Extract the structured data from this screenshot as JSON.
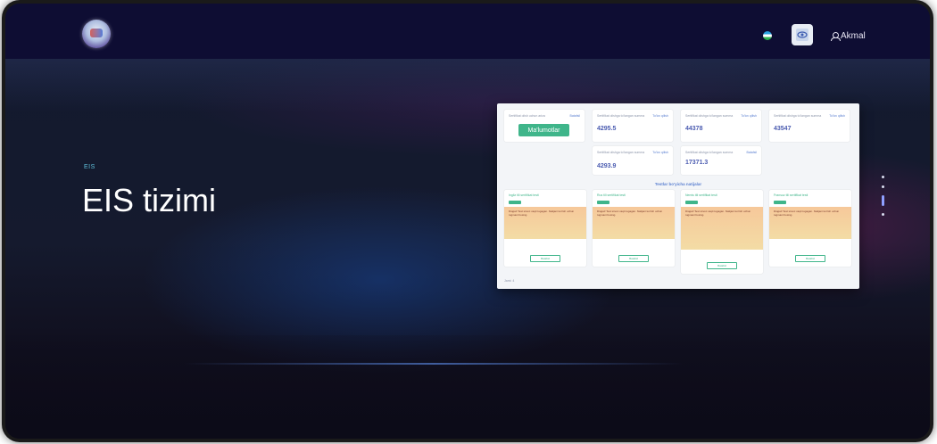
{
  "header": {
    "logo": "eis-logo",
    "language_flag": "uz-flag-icon",
    "accessibility_icon": "eye-search-icon",
    "user_label": "Akmal"
  },
  "hero": {
    "eyebrow": "EIS",
    "title": "EIS tizimi"
  },
  "slider": {
    "count": 4,
    "active_index": 3
  },
  "dashboard_preview": {
    "top_cards": [
      {
        "label": "Sertifikat olish uchun ariza",
        "link": "Batafsil",
        "cta": "Ma'lumotlar",
        "value": ""
      },
      {
        "label": "Sertifikat olishga to'langan summa",
        "link": "To'lov qilish",
        "value": "4295.5"
      },
      {
        "label": "Sertifikat olishga to'langan summa",
        "link": "To'lov qilish",
        "value": "44378"
      },
      {
        "label": "Sertifikat olishga to'langan summa",
        "link": "To'lov qilish",
        "value": "43547"
      },
      {
        "label": "Sertifikat olishga to'langan summa",
        "link": "To'lov qilish",
        "value": "4293.9"
      },
      {
        "label": "Sertifikat olishga to'langan summa",
        "link": "Batafsil",
        "value": "17371.3"
      }
    ],
    "section_title": "Testlar bo'yicha natijalar",
    "tests": [
      {
        "title": "Ingliz tili sertifikat testi",
        "warning": "Diqqat! Test sinovi vaqti tugagan. Natijani ko'rish uchun tugmani bosing.",
        "button": "Batafsil"
      },
      {
        "title": "Rus tili sertifikat testi",
        "warning": "Diqqat! Test sinovi vaqti tugagan. Natijani ko'rish uchun tugmani bosing.",
        "button": "Batafsil"
      },
      {
        "title": "Nemis tili sertifikat testi",
        "warning": "Diqqat! Test sinovi vaqti tugagan. Natijani ko'rish uchun tugmani bosing.",
        "button": "Batafsil"
      },
      {
        "title": "Fransuz tili sertifikat testi",
        "warning": "Diqqat! Test sinovi vaqti tugagan. Natijani ko'rish uchun tugmani bosing.",
        "button": "Batafsil"
      }
    ],
    "footer": "Jami: 4"
  }
}
